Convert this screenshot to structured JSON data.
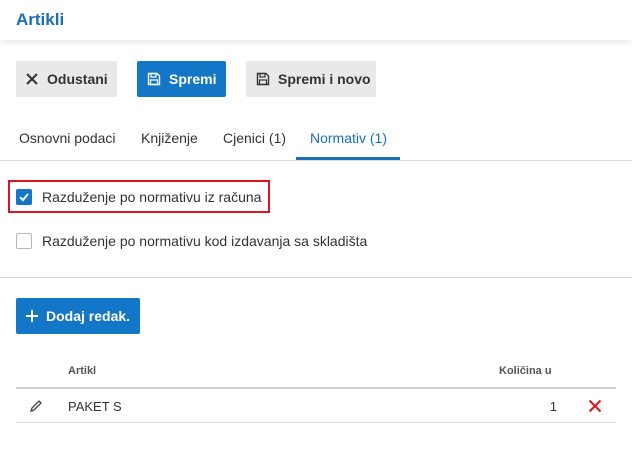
{
  "header": {
    "title": "Artikli"
  },
  "toolbar": {
    "cancel_label": "Odustani",
    "save_label": "Spremi",
    "save_new_label": "Spremi i novo"
  },
  "tabs": [
    {
      "label": "Osnovni podaci",
      "active": false
    },
    {
      "label": "Knjiženje",
      "active": false
    },
    {
      "label": "Cjenici (1)",
      "active": false
    },
    {
      "label": "Normativ (1)",
      "active": true
    }
  ],
  "options": {
    "invoice_normative": {
      "label": "Razduženje po normativu iz računa",
      "checked": true
    },
    "warehouse_normative": {
      "label": "Razduženje po normativu kod izdavanja sa skladišta",
      "checked": false
    }
  },
  "add_row_label": "Dodaj redak.",
  "table": {
    "columns": {
      "item": "Artikl",
      "quantity": "Količina u"
    },
    "rows": [
      {
        "item": "PAKET S",
        "quantity": "1"
      }
    ]
  },
  "colors": {
    "accent": "#1476c6",
    "title": "#1a6fb5",
    "highlight": "#e0141e",
    "delete": "#e0141e"
  }
}
